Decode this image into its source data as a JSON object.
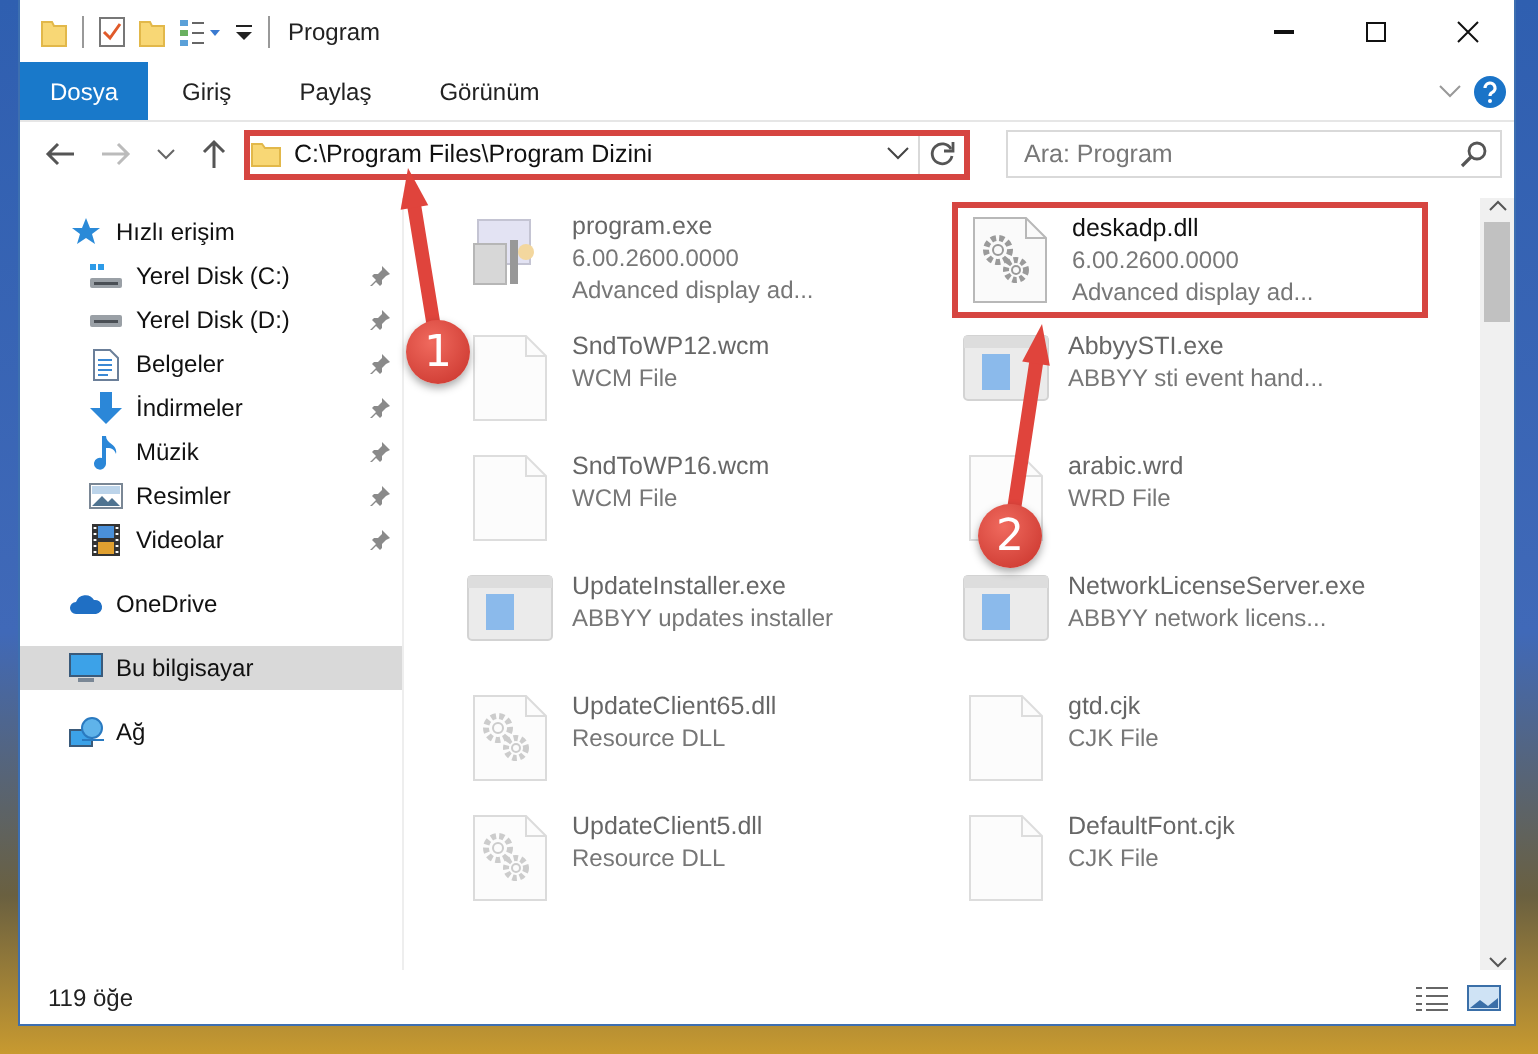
{
  "window": {
    "title": "Program"
  },
  "ribbon_tabs": [
    {
      "label": "Dosya",
      "selected": true
    },
    {
      "label": "Giriş",
      "selected": false
    },
    {
      "label": "Paylaş",
      "selected": false
    },
    {
      "label": "Görünüm",
      "selected": false
    }
  ],
  "address": {
    "path": "C:\\Program Files\\Program Dizini",
    "highlighted": true
  },
  "search": {
    "placeholder": "Ara: Program"
  },
  "nav": [
    {
      "label": "Hızlı erişim",
      "kind": "quick",
      "selected": false,
      "children": [
        {
          "label": "Yerel Disk (C:)",
          "kind": "system-drive",
          "selected": false,
          "pinned": true
        },
        {
          "label": "Yerel Disk (D:)",
          "kind": "drive",
          "selected": false,
          "pinned": true
        },
        {
          "label": "Belgeler",
          "kind": "documents",
          "selected": false,
          "pinned": true
        },
        {
          "label": "İndirmeler",
          "kind": "downloads",
          "selected": false,
          "pinned": true
        },
        {
          "label": "Müzik",
          "kind": "music",
          "selected": false,
          "pinned": true
        },
        {
          "label": "Resimler",
          "kind": "pictures",
          "selected": false,
          "pinned": true
        },
        {
          "label": "Videolar",
          "kind": "videos",
          "selected": false,
          "pinned": true
        }
      ]
    },
    {
      "label": "OneDrive",
      "kind": "cloud",
      "selected": false
    },
    {
      "label": "Bu bilgisayar",
      "kind": "computer",
      "selected": true
    },
    {
      "label": "Ağ",
      "kind": "network",
      "selected": false
    }
  ],
  "files": [
    {
      "name": "program.exe",
      "details": [
        "6.00.2600.0000",
        "Advanced display ad..."
      ],
      "kind": "program",
      "blurred": true,
      "highlighted": false
    },
    {
      "name": "deskadp.dll",
      "details": [
        "6.00.2600.0000",
        "Advanced display ad..."
      ],
      "kind": "gear-file",
      "blurred": false,
      "highlighted": true
    },
    {
      "name": "SndToWP12.wcm",
      "details": [
        "WCM File"
      ],
      "kind": "blank",
      "blurred": true,
      "highlighted": false
    },
    {
      "name": "AbbyySTI.exe",
      "details": [
        "ABBYY sti event hand..."
      ],
      "kind": "app",
      "blurred": true,
      "highlighted": false
    },
    {
      "name": "SndToWP16.wcm",
      "details": [
        "WCM File"
      ],
      "kind": "blank",
      "blurred": true,
      "highlighted": false
    },
    {
      "name": "arabic.wrd",
      "details": [
        "WRD File"
      ],
      "kind": "blank",
      "blurred": true,
      "highlighted": false
    },
    {
      "name": "UpdateInstaller.exe",
      "details": [
        "ABBYY updates installer"
      ],
      "kind": "app",
      "blurred": true,
      "highlighted": false
    },
    {
      "name": "NetworkLicenseServer.exe",
      "details": [
        "ABBYY network licens..."
      ],
      "kind": "app",
      "blurred": true,
      "highlighted": false
    },
    {
      "name": "UpdateClient65.dll",
      "details": [
        "Resource DLL"
      ],
      "kind": "gear-file",
      "blurred": true,
      "highlighted": false
    },
    {
      "name": "gtd.cjk",
      "details": [
        "CJK File"
      ],
      "kind": "blank",
      "blurred": true,
      "highlighted": false
    },
    {
      "name": "UpdateClient5.dll",
      "details": [
        "Resource DLL"
      ],
      "kind": "gear-file",
      "blurred": true,
      "highlighted": false
    },
    {
      "name": "DefaultFont.cjk",
      "details": [
        "CJK File"
      ],
      "kind": "blank",
      "blurred": true,
      "highlighted": false
    }
  ],
  "status_bar": {
    "count": "119 öğe"
  },
  "callouts": [
    {
      "number": "1"
    },
    {
      "number": "2"
    }
  ]
}
